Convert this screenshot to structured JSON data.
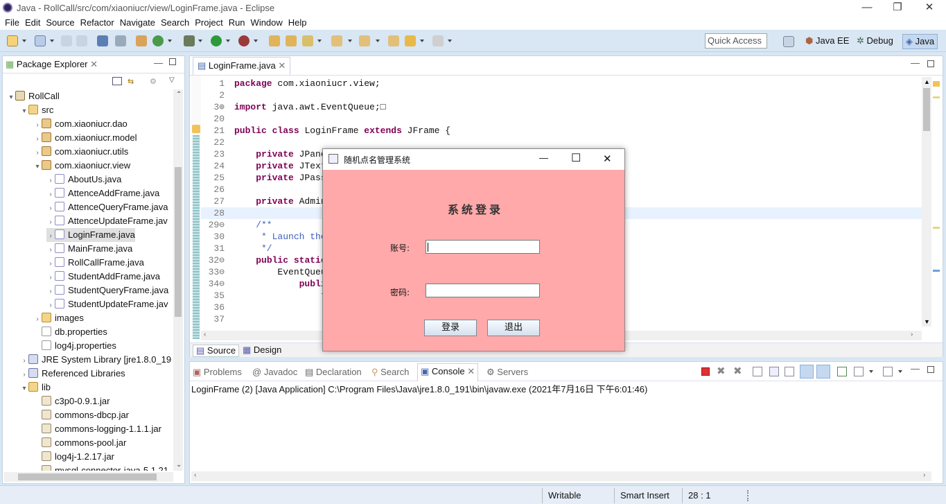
{
  "window": {
    "title": "Java - RollCall/src/com/xiaoniucr/view/LoginFrame.java - Eclipse",
    "minimize": "—",
    "maximize": "❐",
    "close": "✕"
  },
  "menu": [
    "File",
    "Edit",
    "Source",
    "Refactor",
    "Navigate",
    "Search",
    "Project",
    "Run",
    "Window",
    "Help"
  ],
  "quick_access": "Quick Access",
  "perspectives": [
    "Java EE",
    "Debug",
    "Java"
  ],
  "package_explorer": {
    "title": "Package Explorer",
    "tree": [
      {
        "label": "RollCall",
        "indent": 0,
        "arrow": "▾",
        "icon": "proj"
      },
      {
        "label": "src",
        "indent": 1,
        "arrow": "▾",
        "icon": "folder"
      },
      {
        "label": "com.xiaoniucr.dao",
        "indent": 2,
        "arrow": "›",
        "icon": "pkg"
      },
      {
        "label": "com.xiaoniucr.model",
        "indent": 2,
        "arrow": "›",
        "icon": "pkg"
      },
      {
        "label": "com.xiaoniucr.utils",
        "indent": 2,
        "arrow": "›",
        "icon": "pkg"
      },
      {
        "label": "com.xiaoniucr.view",
        "indent": 2,
        "arrow": "▾",
        "icon": "pkg"
      },
      {
        "label": "AboutUs.java",
        "indent": 3,
        "arrow": "›",
        "icon": "java"
      },
      {
        "label": "AttenceAddFrame.java",
        "indent": 3,
        "arrow": "›",
        "icon": "java"
      },
      {
        "label": "AttenceQueryFrame.java",
        "indent": 3,
        "arrow": "›",
        "icon": "java"
      },
      {
        "label": "AttenceUpdateFrame.jav",
        "indent": 3,
        "arrow": "›",
        "icon": "java"
      },
      {
        "label": "LoginFrame.java",
        "indent": 3,
        "arrow": "›",
        "icon": "java",
        "selected": true
      },
      {
        "label": "MainFrame.java",
        "indent": 3,
        "arrow": "›",
        "icon": "java"
      },
      {
        "label": "RollCallFrame.java",
        "indent": 3,
        "arrow": "›",
        "icon": "java"
      },
      {
        "label": "StudentAddFrame.java",
        "indent": 3,
        "arrow": "›",
        "icon": "java"
      },
      {
        "label": "StudentQueryFrame.java",
        "indent": 3,
        "arrow": "›",
        "icon": "java"
      },
      {
        "label": "StudentUpdateFrame.jav",
        "indent": 3,
        "arrow": "›",
        "icon": "java"
      },
      {
        "label": "images",
        "indent": 2,
        "arrow": "›",
        "icon": "folder"
      },
      {
        "label": "db.properties",
        "indent": 2,
        "arrow": "",
        "icon": "file"
      },
      {
        "label": "log4j.properties",
        "indent": 2,
        "arrow": "",
        "icon": "file"
      },
      {
        "label": "JRE System Library [jre1.8.0_19",
        "indent": 1,
        "arrow": "›",
        "icon": "lib"
      },
      {
        "label": "Referenced Libraries",
        "indent": 1,
        "arrow": "›",
        "icon": "lib"
      },
      {
        "label": "lib",
        "indent": 1,
        "arrow": "▾",
        "icon": "folder"
      },
      {
        "label": "c3p0-0.9.1.jar",
        "indent": 2,
        "arrow": "",
        "icon": "jar"
      },
      {
        "label": "commons-dbcp.jar",
        "indent": 2,
        "arrow": "",
        "icon": "jar"
      },
      {
        "label": "commons-logging-1.1.1.jar",
        "indent": 2,
        "arrow": "",
        "icon": "jar"
      },
      {
        "label": "commons-pool.jar",
        "indent": 2,
        "arrow": "",
        "icon": "jar"
      },
      {
        "label": "log4j-1.2.17.jar",
        "indent": 2,
        "arrow": "",
        "icon": "jar"
      },
      {
        "label": "mysql-connector-java-5.1.21",
        "indent": 2,
        "arrow": "",
        "icon": "jar"
      }
    ]
  },
  "editor": {
    "tab": "LoginFrame.java",
    "lines": [
      {
        "n": "1",
        "t": "package com.xiaoniucr.view;"
      },
      {
        "n": "2",
        "t": ""
      },
      {
        "n": "3⊕",
        "t": "import java.awt.EventQueue;□"
      },
      {
        "n": "20",
        "t": ""
      },
      {
        "n": "21",
        "t": "public class LoginFrame extends JFrame {"
      },
      {
        "n": "22",
        "t": ""
      },
      {
        "n": "23",
        "t": "    private JPanel"
      },
      {
        "n": "24",
        "t": "    private JTextF"
      },
      {
        "n": "25",
        "t": "    private JPassw"
      },
      {
        "n": "26",
        "t": ""
      },
      {
        "n": "27",
        "t": "    private AdminD"
      },
      {
        "n": "28",
        "t": ""
      },
      {
        "n": "29⊖",
        "t": "    /**"
      },
      {
        "n": "30",
        "t": "     * Launch the"
      },
      {
        "n": "31",
        "t": "     */"
      },
      {
        "n": "32⊖",
        "t": "    public static"
      },
      {
        "n": "33⊖",
        "t": "        EventQueue"
      },
      {
        "n": "34⊖",
        "t": "            public"
      },
      {
        "n": "35",
        "t": "                tr"
      },
      {
        "n": "36",
        "t": ""
      },
      {
        "n": "37",
        "t": ""
      }
    ],
    "bottom_tabs": [
      "Source",
      "Design"
    ]
  },
  "console": {
    "tabs": [
      "Problems",
      "Javadoc",
      "Declaration",
      "Search",
      "Console",
      "Servers"
    ],
    "active_tab": "Console",
    "header": "LoginFrame (2) [Java Application] C:\\Program Files\\Java\\jre1.8.0_191\\bin\\javaw.exe (2021年7月16日 下午6:01:46)"
  },
  "status": {
    "writable": "Writable",
    "insert": "Smart Insert",
    "position": "28 : 1"
  },
  "dialog": {
    "title": "随机点名管理系统",
    "heading": "系统登录",
    "account_label": "账号:",
    "password_label": "密码:",
    "login_button": "登录",
    "exit_button": "退出",
    "min": "—",
    "max": "☐",
    "close": "✕",
    "bg_color": "#ffa9aa"
  }
}
